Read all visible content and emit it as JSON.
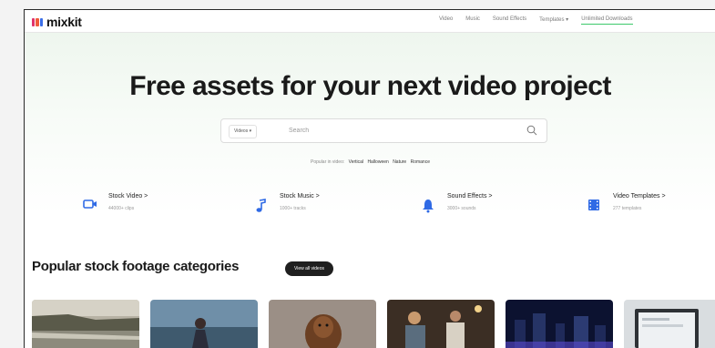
{
  "brand": {
    "name": "mixkit"
  },
  "nav": {
    "links": [
      "Video",
      "Music",
      "Sound Effects",
      "Templates ▾"
    ],
    "cta": "Unlimited Downloads"
  },
  "hero": {
    "title": "Free assets for your next video project"
  },
  "search": {
    "category": "Videos ▾",
    "placeholder": "Search",
    "value": ""
  },
  "popular": {
    "label": "Popular in video:",
    "tags": [
      "Vertical",
      "Halloween",
      "Nature",
      "Romance"
    ]
  },
  "categories": [
    {
      "title": "Stock Video >",
      "subtitle": "44000+ clips",
      "icon": "video-camera-icon"
    },
    {
      "title": "Stock Music >",
      "subtitle": "1000+ tracks",
      "icon": "music-note-icon"
    },
    {
      "title": "Sound Effects >",
      "subtitle": "3000+ sounds",
      "icon": "bell-icon"
    },
    {
      "title": "Video Templates >",
      "subtitle": "277 templates",
      "icon": "film-strip-icon"
    }
  ],
  "section": {
    "title": "Popular stock footage categories",
    "button": "View all videos"
  },
  "colors": {
    "accent_green": "#3dc96b",
    "icon_blue": "#2f6ae5",
    "dark_button": "#1f1f1f"
  },
  "thumbnails": [
    "river-landscape-thumbnail",
    "woman-outdoors-thumbnail",
    "dog-portrait-thumbnail",
    "people-dinner-thumbnail",
    "city-night-thumbnail",
    "laptop-screen-thumbnail"
  ]
}
